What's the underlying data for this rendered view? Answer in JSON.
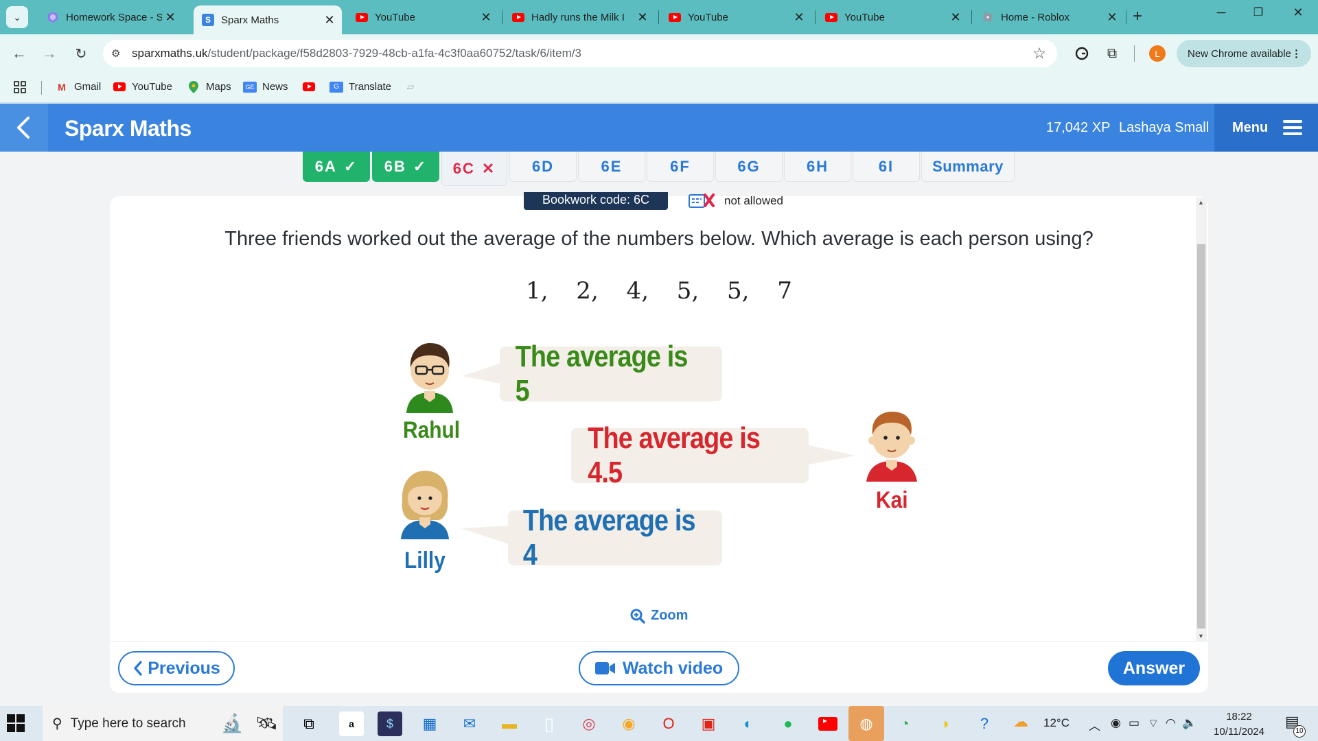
{
  "browser": {
    "tabs": [
      {
        "title": "Homework Space - S",
        "favicon": "homework-icon",
        "active": false
      },
      {
        "title": "Sparx Maths",
        "favicon": "sparx-icon",
        "active": true
      },
      {
        "title": "YouTube",
        "favicon": "youtube-icon",
        "active": false
      },
      {
        "title": "Hadly runs the Milk I",
        "favicon": "youtube-icon",
        "active": false
      },
      {
        "title": "YouTube",
        "favicon": "youtube-icon",
        "active": false
      },
      {
        "title": "YouTube",
        "favicon": "youtube-icon",
        "active": false
      },
      {
        "title": "Home - Roblox",
        "favicon": "roblox-icon",
        "active": false
      }
    ],
    "url_domain": "sparxmaths.uk",
    "url_path": "/student/package/f58d2803-7929-48cb-a1fa-4c3f0aa60752/task/6/item/3",
    "profile_initial": "L",
    "update_label": "New Chrome available",
    "bookmarks": [
      {
        "label": "Gmail",
        "icon": "gmail-icon"
      },
      {
        "label": "YouTube",
        "icon": "youtube-icon"
      },
      {
        "label": "Maps",
        "icon": "maps-icon"
      },
      {
        "label": "News",
        "icon": "news-icon"
      },
      {
        "label": "",
        "icon": "youtube-icon"
      },
      {
        "label": "Translate",
        "icon": "translate-icon"
      }
    ]
  },
  "header": {
    "brand": "Sparx Maths",
    "xp": "17,042 XP",
    "student_name": "Lashaya Small",
    "menu_label": "Menu"
  },
  "task_tabs": [
    {
      "label": "6A",
      "state": "correct"
    },
    {
      "label": "6B",
      "state": "correct"
    },
    {
      "label": "6C",
      "state": "wrong"
    },
    {
      "label": "6D",
      "state": "todo"
    },
    {
      "label": "6E",
      "state": "todo"
    },
    {
      "label": "6F",
      "state": "todo"
    },
    {
      "label": "6G",
      "state": "todo"
    },
    {
      "label": "6H",
      "state": "todo"
    },
    {
      "label": "6I",
      "state": "todo"
    },
    {
      "label": "Summary",
      "state": "todo"
    }
  ],
  "question": {
    "bookwork_code": "Bookwork code: 6C",
    "calculator_note": "not allowed",
    "prompt": "Three friends worked out the average of the numbers below. Which average is each person using?",
    "numbers": "1,   2,   4,   5,   5,   7",
    "people": [
      {
        "name": "Rahul",
        "statement": "The average is 5",
        "color": "#3a8a1a"
      },
      {
        "name": "Kai",
        "statement": "The average is 4.5",
        "color": "#d7262e"
      },
      {
        "name": "Lilly",
        "statement": "The average is 4",
        "color": "#1f6fb2"
      }
    ],
    "zoom_label": "Zoom"
  },
  "actions": {
    "previous": "Previous",
    "watch_video": "Watch video",
    "answer": "Answer"
  },
  "colors": {
    "header_blue": "#3a84df",
    "correct_green": "#21b36b",
    "wrong_red": "#e0284b",
    "action_blue": "#1f74d6"
  },
  "taskbar": {
    "search_placeholder": "Type here to search",
    "weather": "12°C",
    "time": "18:22",
    "date": "10/11/2024",
    "notification_count": "10"
  }
}
